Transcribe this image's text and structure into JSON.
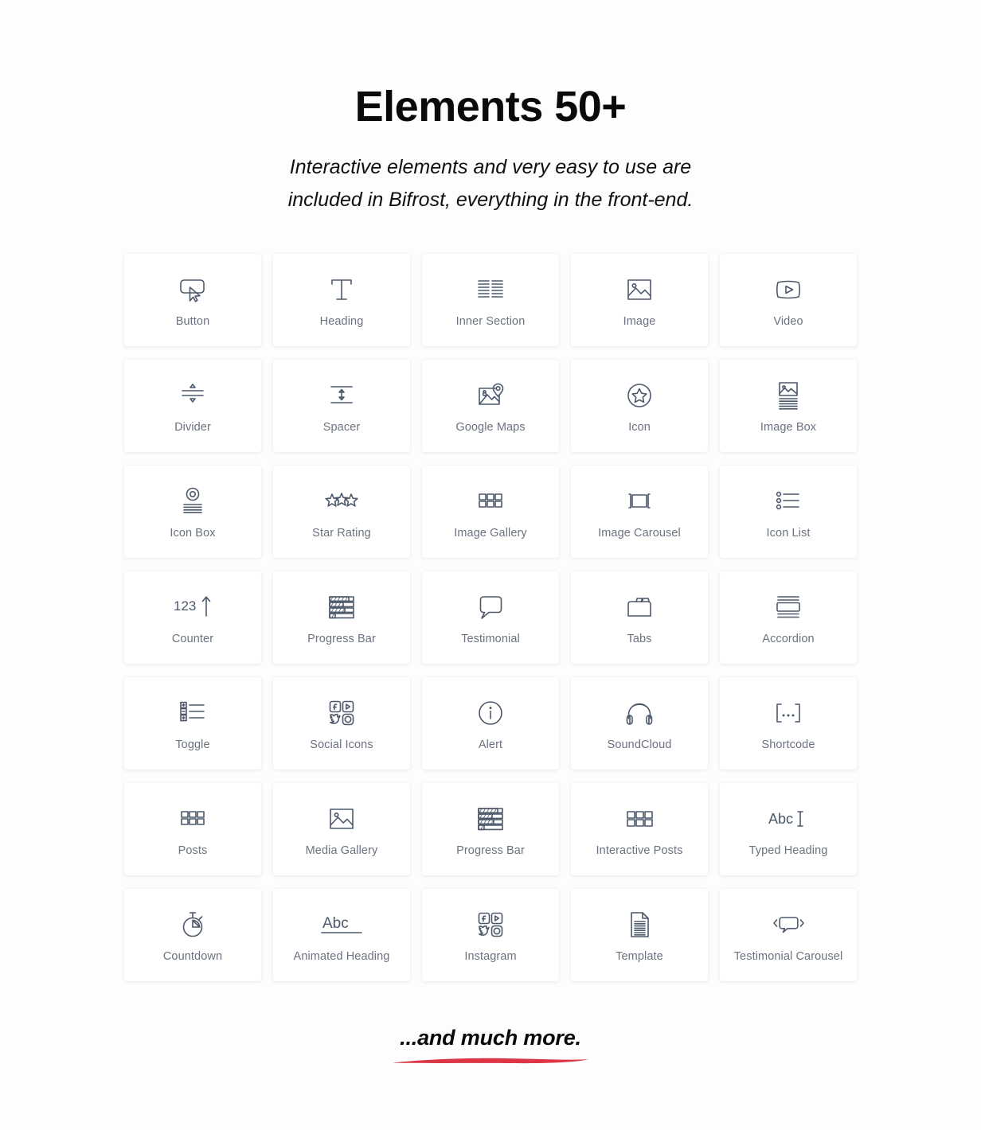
{
  "header": {
    "title": "Elements 50+",
    "subtitle_line1": "Interactive elements and very easy to use are",
    "subtitle_line2": "included in Bifrost, everything in the front-end."
  },
  "footer": {
    "text": "...and much more.",
    "underline_color": "#dc3545"
  },
  "theme": {
    "page_background": "#fdfdfd",
    "card_background": "#ffffff",
    "icon_color": "#4d586b",
    "label_color": "#6b7280",
    "title_color": "#0a0a0a"
  },
  "grid": {
    "columns": 5,
    "rows": 7,
    "count": 35,
    "items": [
      {
        "label": "Button",
        "icon": "button-cursor-icon"
      },
      {
        "label": "Heading",
        "icon": "heading-t-icon"
      },
      {
        "label": "Inner Section",
        "icon": "inner-section-columns-icon"
      },
      {
        "label": "Image",
        "icon": "image-picture-icon"
      },
      {
        "label": "Video",
        "icon": "video-play-icon"
      },
      {
        "label": "Divider",
        "icon": "divider-icon"
      },
      {
        "label": "Spacer",
        "icon": "spacer-icon"
      },
      {
        "label": "Google Maps",
        "icon": "google-maps-pin-icon"
      },
      {
        "label": "Icon",
        "icon": "star-circle-icon"
      },
      {
        "label": "Image Box",
        "icon": "image-box-icon"
      },
      {
        "label": "Icon Box",
        "icon": "icon-box-target-icon"
      },
      {
        "label": "Star Rating",
        "icon": "star-rating-icon"
      },
      {
        "label": "Image Gallery",
        "icon": "gallery-grid-icon"
      },
      {
        "label": "Image Carousel",
        "icon": "carousel-icon"
      },
      {
        "label": "Icon List",
        "icon": "icon-list-icon"
      },
      {
        "label": "Counter",
        "icon": "counter-123-arrow-icon"
      },
      {
        "label": "Progress Bar",
        "icon": "progress-bar-icon"
      },
      {
        "label": "Testimonial",
        "icon": "speech-bubble-icon"
      },
      {
        "label": "Tabs",
        "icon": "tabs-folder-icon"
      },
      {
        "label": "Accordion",
        "icon": "accordion-icon"
      },
      {
        "label": "Toggle",
        "icon": "toggle-plus-list-icon"
      },
      {
        "label": "Social Icons",
        "icon": "social-icons-icon"
      },
      {
        "label": "Alert",
        "icon": "alert-info-circle-icon"
      },
      {
        "label": "SoundCloud",
        "icon": "headphones-icon"
      },
      {
        "label": "Shortcode",
        "icon": "shortcode-brackets-icon"
      },
      {
        "label": "Posts",
        "icon": "posts-grid-icon"
      },
      {
        "label": "Media Gallery",
        "icon": "media-gallery-picture-icon"
      },
      {
        "label": "Progress Bar",
        "icon": "progress-bar-icon"
      },
      {
        "label": "Interactive Posts",
        "icon": "interactive-posts-grid-icon"
      },
      {
        "label": "Typed Heading",
        "icon": "typed-heading-abc-caret-icon"
      },
      {
        "label": "Countdown",
        "icon": "stopwatch-icon"
      },
      {
        "label": "Animated Heading",
        "icon": "animated-heading-abc-icon"
      },
      {
        "label": "Instagram",
        "icon": "social-icons-icon"
      },
      {
        "label": "Template",
        "icon": "template-document-icon"
      },
      {
        "label": "Testimonial Carousel",
        "icon": "testimonial-carousel-icon"
      }
    ]
  },
  "counter_value": "123",
  "abc_text": "Abc",
  "shortcode_text": "[…]"
}
